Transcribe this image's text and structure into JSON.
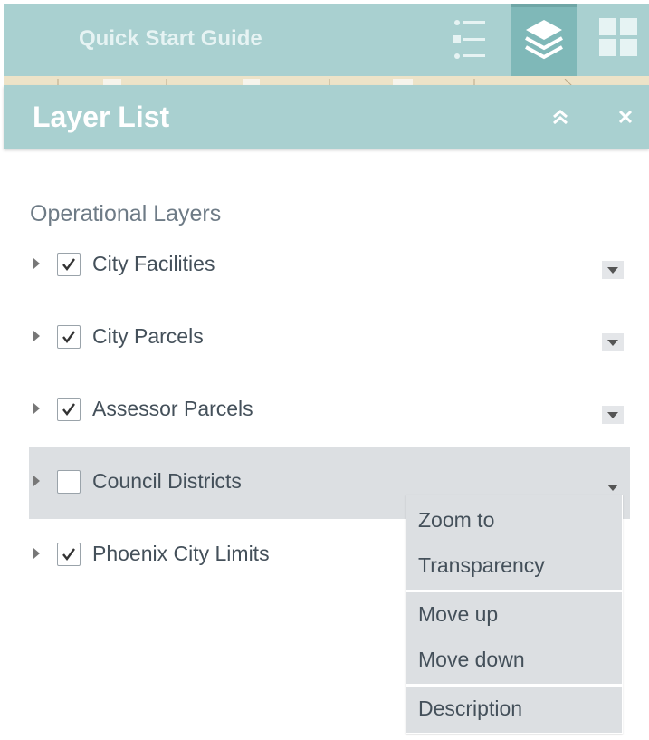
{
  "toolbar": {
    "quick_start_label": "Quick Start Guide",
    "buttons": [
      {
        "icon": "list-icon"
      },
      {
        "icon": "layers-icon",
        "active": true
      },
      {
        "icon": "grid-icon"
      }
    ]
  },
  "panel": {
    "title": "Layer List",
    "collapse_icon": "double-chevron-up-icon",
    "close_icon": "close-icon"
  },
  "section_title": "Operational Layers",
  "layers": [
    {
      "label": "City Facilities",
      "checked": true
    },
    {
      "label": "City Parcels",
      "checked": true
    },
    {
      "label": "Assessor Parcels",
      "checked": true
    },
    {
      "label": "Council Districts",
      "checked": false,
      "menu_open": true
    },
    {
      "label": "Phoenix City Limits",
      "checked": true
    }
  ],
  "menu": {
    "items": [
      "Zoom to",
      "Transparency",
      "Move up",
      "Move down",
      "Description"
    ]
  },
  "colors": {
    "header_bg": "#a9d0d0",
    "active_button_bg": "#7fb8b8",
    "selected_row_bg": "#dcdfe2",
    "text": "#44505a"
  }
}
